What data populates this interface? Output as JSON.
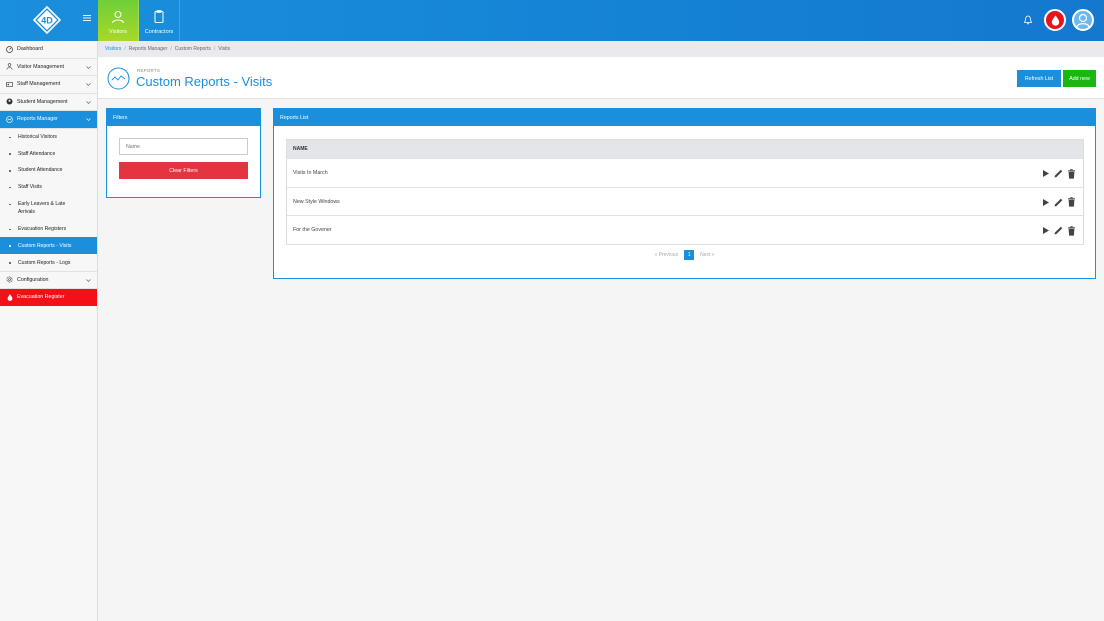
{
  "topnav": {
    "logo_text": "4D",
    "tabs": [
      {
        "label": "Visitors",
        "icon": "person-icon",
        "active": true
      },
      {
        "label": "Contractors",
        "icon": "clipboard-icon",
        "active": false
      }
    ],
    "accent_color": "#1a8fdc",
    "active_tab_color": "#8dd22f"
  },
  "sidebar": {
    "items": [
      {
        "label": "Dashboard",
        "icon": "dashboard-icon"
      },
      {
        "label": "Visitor Management",
        "icon": "people-icon",
        "expandable": true
      },
      {
        "label": "Staff Management",
        "icon": "id-card-icon",
        "expandable": true
      },
      {
        "label": "Student Management",
        "icon": "student-icon",
        "expandable": true
      },
      {
        "label": "Reports Manager",
        "icon": "reports-icon",
        "expandable": true,
        "active": true
      }
    ],
    "sub_items": [
      {
        "label": "Historical Visitors"
      },
      {
        "label": "Staff Attendance"
      },
      {
        "label": "Student Attendance"
      },
      {
        "label": "Staff Visits"
      },
      {
        "label_line1": "Early Leavers & Late",
        "label_line2": "Arrivals"
      },
      {
        "label": "Evacuation Registers"
      },
      {
        "label": "Custom Reports - Visits",
        "active": true
      },
      {
        "label": "Custom Reports - Logs"
      }
    ],
    "configuration": {
      "label": "Configuration",
      "icon": "gear-icon"
    },
    "evacuation": {
      "label": "Evacuation Register",
      "icon": "drop-icon",
      "color": "#f50f16"
    }
  },
  "breadcrumb": [
    "Visitors",
    "Reports Manager",
    "Custom Reports",
    "Visits"
  ],
  "header": {
    "small_label": "REPORTS",
    "title": "Custom Reports - Visits",
    "refresh_label": "Refresh List",
    "add_label": "Add new"
  },
  "filters": {
    "title": "Filters",
    "name_placeholder": "Name",
    "clear_label": "Clear Filters"
  },
  "reports": {
    "title": "Reports List",
    "column": "NAME",
    "rows": [
      {
        "name": "Visits In March"
      },
      {
        "name": "New Style Windows"
      },
      {
        "name": "For the Govener"
      }
    ],
    "pager": {
      "prev": "« Previous",
      "page": "1",
      "next": "Next »"
    }
  }
}
